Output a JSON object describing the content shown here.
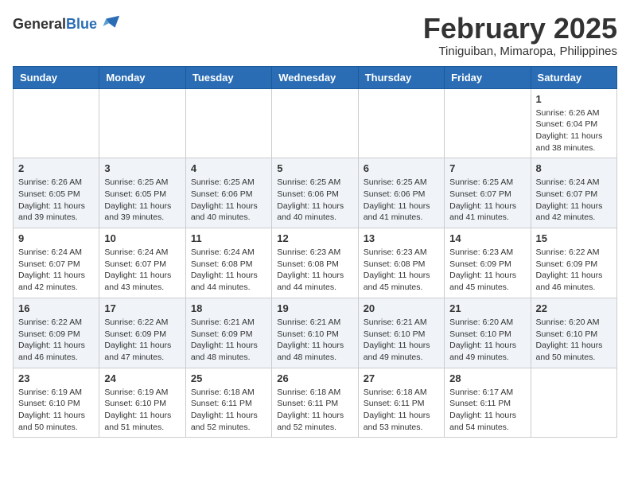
{
  "header": {
    "logo_general": "General",
    "logo_blue": "Blue",
    "month_year": "February 2025",
    "location": "Tiniguiban, Mimaropa, Philippines"
  },
  "days_of_week": [
    "Sunday",
    "Monday",
    "Tuesday",
    "Wednesday",
    "Thursday",
    "Friday",
    "Saturday"
  ],
  "weeks": [
    [
      {
        "day": "",
        "info": ""
      },
      {
        "day": "",
        "info": ""
      },
      {
        "day": "",
        "info": ""
      },
      {
        "day": "",
        "info": ""
      },
      {
        "day": "",
        "info": ""
      },
      {
        "day": "",
        "info": ""
      },
      {
        "day": "1",
        "info": "Sunrise: 6:26 AM\nSunset: 6:04 PM\nDaylight: 11 hours and 38 minutes."
      }
    ],
    [
      {
        "day": "2",
        "info": "Sunrise: 6:26 AM\nSunset: 6:05 PM\nDaylight: 11 hours and 39 minutes."
      },
      {
        "day": "3",
        "info": "Sunrise: 6:25 AM\nSunset: 6:05 PM\nDaylight: 11 hours and 39 minutes."
      },
      {
        "day": "4",
        "info": "Sunrise: 6:25 AM\nSunset: 6:06 PM\nDaylight: 11 hours and 40 minutes."
      },
      {
        "day": "5",
        "info": "Sunrise: 6:25 AM\nSunset: 6:06 PM\nDaylight: 11 hours and 40 minutes."
      },
      {
        "day": "6",
        "info": "Sunrise: 6:25 AM\nSunset: 6:06 PM\nDaylight: 11 hours and 41 minutes."
      },
      {
        "day": "7",
        "info": "Sunrise: 6:25 AM\nSunset: 6:07 PM\nDaylight: 11 hours and 41 minutes."
      },
      {
        "day": "8",
        "info": "Sunrise: 6:24 AM\nSunset: 6:07 PM\nDaylight: 11 hours and 42 minutes."
      }
    ],
    [
      {
        "day": "9",
        "info": "Sunrise: 6:24 AM\nSunset: 6:07 PM\nDaylight: 11 hours and 42 minutes."
      },
      {
        "day": "10",
        "info": "Sunrise: 6:24 AM\nSunset: 6:07 PM\nDaylight: 11 hours and 43 minutes."
      },
      {
        "day": "11",
        "info": "Sunrise: 6:24 AM\nSunset: 6:08 PM\nDaylight: 11 hours and 44 minutes."
      },
      {
        "day": "12",
        "info": "Sunrise: 6:23 AM\nSunset: 6:08 PM\nDaylight: 11 hours and 44 minutes."
      },
      {
        "day": "13",
        "info": "Sunrise: 6:23 AM\nSunset: 6:08 PM\nDaylight: 11 hours and 45 minutes."
      },
      {
        "day": "14",
        "info": "Sunrise: 6:23 AM\nSunset: 6:09 PM\nDaylight: 11 hours and 45 minutes."
      },
      {
        "day": "15",
        "info": "Sunrise: 6:22 AM\nSunset: 6:09 PM\nDaylight: 11 hours and 46 minutes."
      }
    ],
    [
      {
        "day": "16",
        "info": "Sunrise: 6:22 AM\nSunset: 6:09 PM\nDaylight: 11 hours and 46 minutes."
      },
      {
        "day": "17",
        "info": "Sunrise: 6:22 AM\nSunset: 6:09 PM\nDaylight: 11 hours and 47 minutes."
      },
      {
        "day": "18",
        "info": "Sunrise: 6:21 AM\nSunset: 6:09 PM\nDaylight: 11 hours and 48 minutes."
      },
      {
        "day": "19",
        "info": "Sunrise: 6:21 AM\nSunset: 6:10 PM\nDaylight: 11 hours and 48 minutes."
      },
      {
        "day": "20",
        "info": "Sunrise: 6:21 AM\nSunset: 6:10 PM\nDaylight: 11 hours and 49 minutes."
      },
      {
        "day": "21",
        "info": "Sunrise: 6:20 AM\nSunset: 6:10 PM\nDaylight: 11 hours and 49 minutes."
      },
      {
        "day": "22",
        "info": "Sunrise: 6:20 AM\nSunset: 6:10 PM\nDaylight: 11 hours and 50 minutes."
      }
    ],
    [
      {
        "day": "23",
        "info": "Sunrise: 6:19 AM\nSunset: 6:10 PM\nDaylight: 11 hours and 50 minutes."
      },
      {
        "day": "24",
        "info": "Sunrise: 6:19 AM\nSunset: 6:10 PM\nDaylight: 11 hours and 51 minutes."
      },
      {
        "day": "25",
        "info": "Sunrise: 6:18 AM\nSunset: 6:11 PM\nDaylight: 11 hours and 52 minutes."
      },
      {
        "day": "26",
        "info": "Sunrise: 6:18 AM\nSunset: 6:11 PM\nDaylight: 11 hours and 52 minutes."
      },
      {
        "day": "27",
        "info": "Sunrise: 6:18 AM\nSunset: 6:11 PM\nDaylight: 11 hours and 53 minutes."
      },
      {
        "day": "28",
        "info": "Sunrise: 6:17 AM\nSunset: 6:11 PM\nDaylight: 11 hours and 54 minutes."
      },
      {
        "day": "",
        "info": ""
      }
    ]
  ]
}
